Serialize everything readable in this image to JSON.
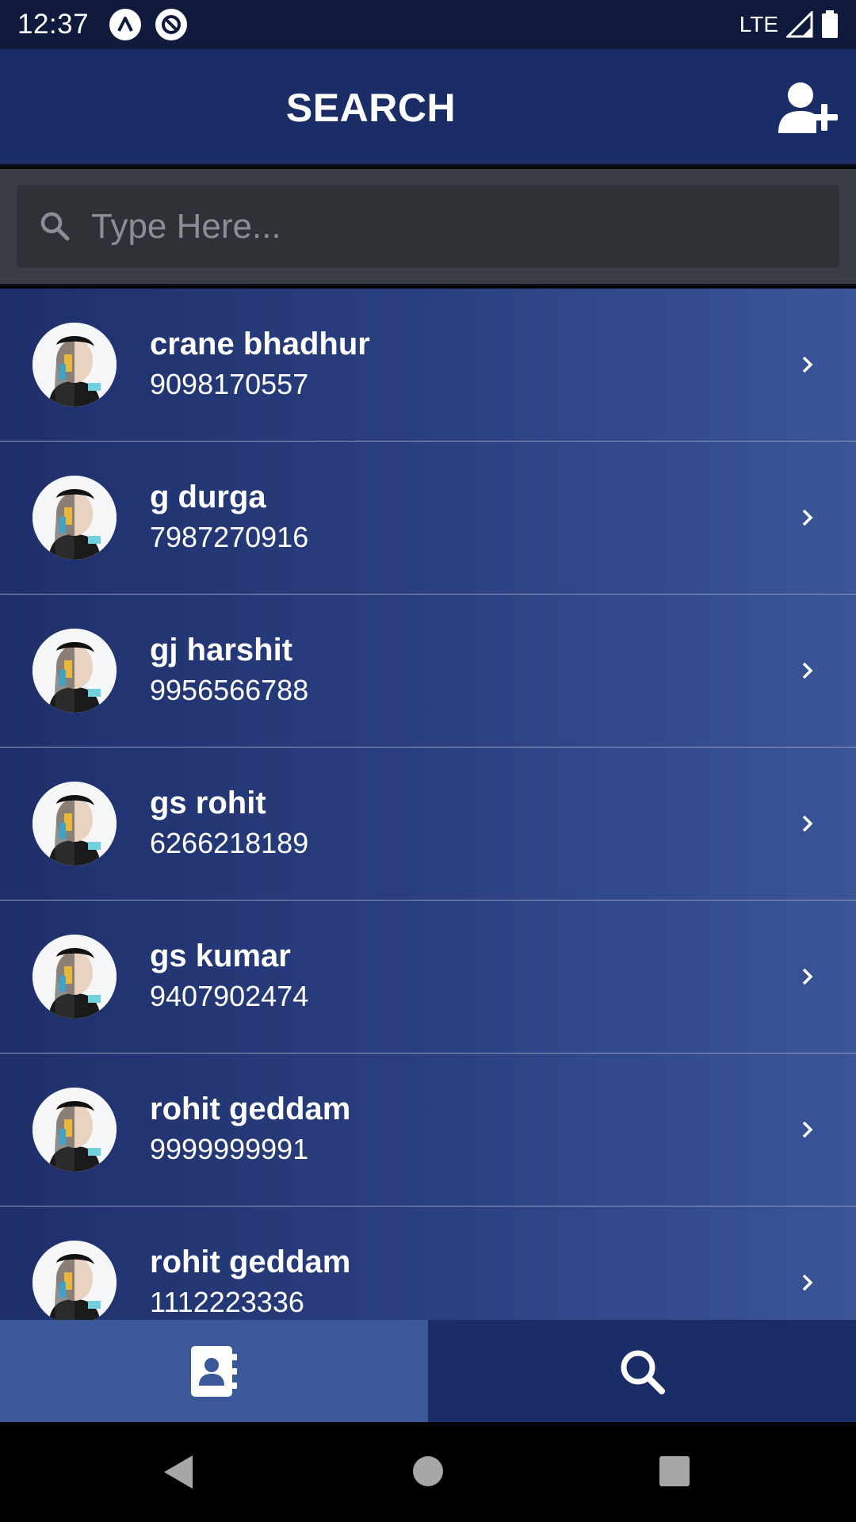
{
  "status_bar": {
    "time": "12:37",
    "network": "LTE",
    "icons": [
      "app-notification-icon",
      "blocked-notification-icon",
      "signal-icon",
      "battery-icon"
    ]
  },
  "header": {
    "title": "SEARCH",
    "add_contact_icon": "add-user-icon"
  },
  "search": {
    "placeholder": "Type Here...",
    "value": "",
    "icon": "search-icon"
  },
  "contacts": [
    {
      "name": "crane bhadhur",
      "phone": "9098170557"
    },
    {
      "name": "g durga",
      "phone": "7987270916"
    },
    {
      "name": "gj harshit",
      "phone": "9956566788"
    },
    {
      "name": "gs rohit",
      "phone": "6266218189"
    },
    {
      "name": "gs kumar",
      "phone": "9407902474"
    },
    {
      "name": "rohit geddam",
      "phone": "9999999991"
    },
    {
      "name": "rohit geddam",
      "phone": "1112223336"
    }
  ],
  "bottom_nav": {
    "tabs": [
      {
        "icon": "contacts-book-icon",
        "active": true
      },
      {
        "icon": "search-icon",
        "active": false
      }
    ]
  },
  "colors": {
    "status_bar": "#0f1a3d",
    "app_bar": "#1b2d66",
    "search_bg": "#3a3d44",
    "active_tab": "#3b5898",
    "inactive_tab": "#1b2d66"
  }
}
